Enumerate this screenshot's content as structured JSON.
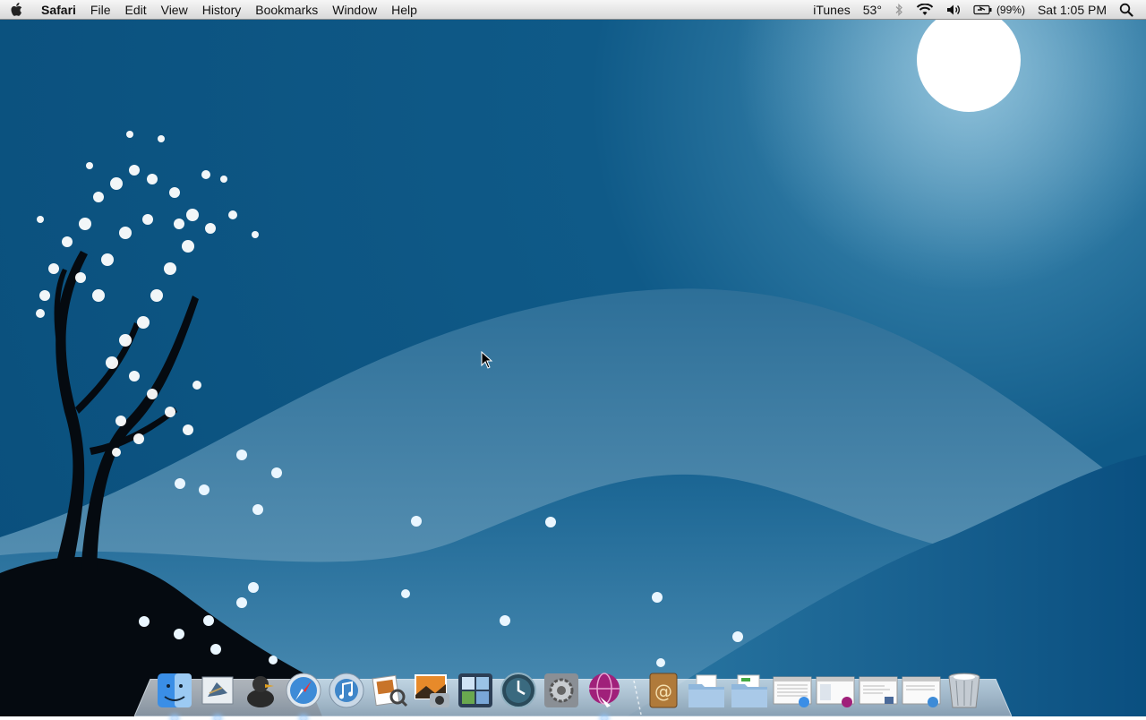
{
  "menubar": {
    "app_name": "Safari",
    "menus": [
      "File",
      "Edit",
      "View",
      "History",
      "Bookmarks",
      "Window",
      "Help"
    ],
    "extras": {
      "itunes_label": "iTunes",
      "weather": "53°",
      "battery_percent": "(99%)",
      "clock": "Sat 1:05 PM"
    }
  },
  "dock": {
    "apps": [
      {
        "icon": "finder-icon",
        "running": true
      },
      {
        "icon": "mail-icon",
        "running": true
      },
      {
        "icon": "adium-duck-icon",
        "running": false
      },
      {
        "icon": "safari-icon",
        "running": true
      },
      {
        "icon": "itunes-icon",
        "running": false
      },
      {
        "icon": "preview-icon",
        "running": false
      },
      {
        "icon": "iphoto-icon",
        "running": false
      },
      {
        "icon": "spaces-icon",
        "running": false
      },
      {
        "icon": "time-machine-icon",
        "running": false
      },
      {
        "icon": "system-preferences-icon",
        "running": false
      },
      {
        "icon": "purple-globe-icon",
        "running": true
      }
    ],
    "stacks": [
      {
        "icon": "address-book-icon"
      },
      {
        "icon": "documents-folder-icon"
      },
      {
        "icon": "downloads-folder-icon"
      },
      {
        "icon": "minimized-window-finder-icon"
      },
      {
        "icon": "minimized-window-itunes-icon"
      },
      {
        "icon": "minimized-window-preview-icon"
      },
      {
        "icon": "minimized-window-safari-icon"
      },
      {
        "icon": "trash-icon"
      }
    ]
  },
  "colors": {
    "sky_deep": "#0a4f7c",
    "hill_back": "#3f80a6",
    "hill_mid": "#1d6892",
    "hill_front": "#0c5485",
    "moon": "#ffffff"
  }
}
